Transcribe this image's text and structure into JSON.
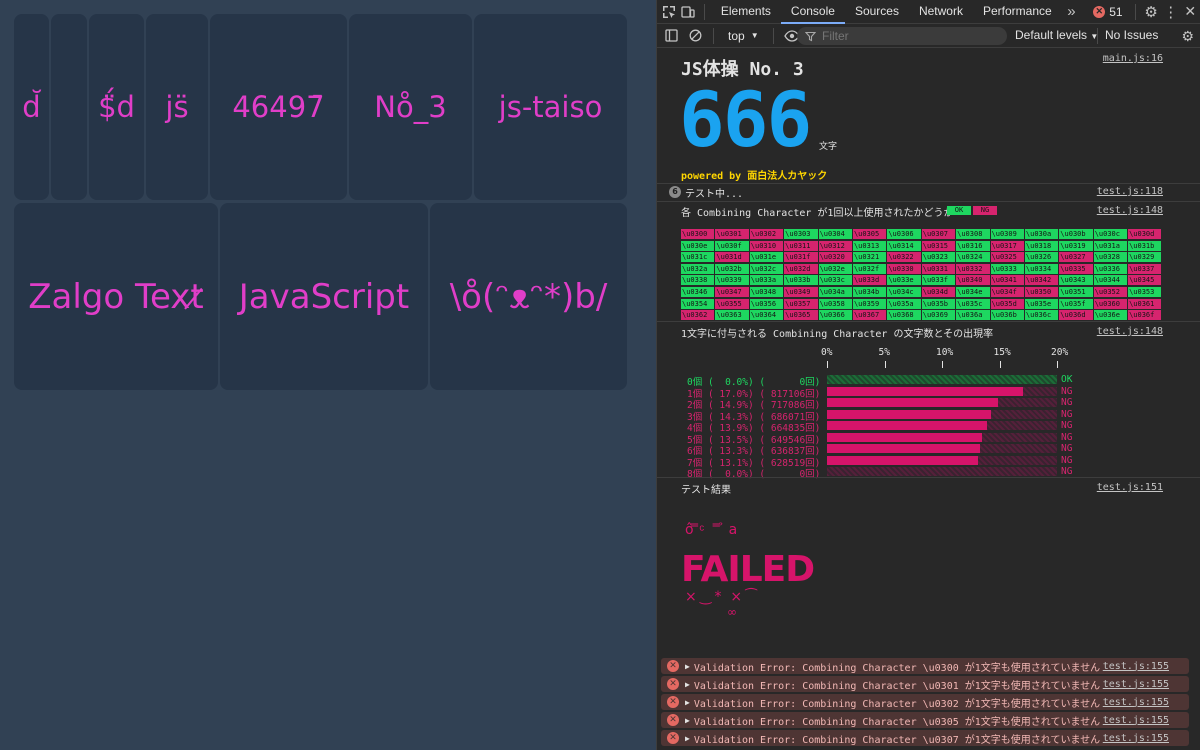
{
  "left_tiles": {
    "row1": [
      {
        "text": "d̆"
      },
      {
        "text": "$̈́d"
      },
      {
        "text": "js̈"
      },
      {
        "text": "46497̄"
      },
      {
        "text": "No̊_3"
      },
      {
        "text": "js-taiso"
      }
    ],
    "row2": [
      {
        "text": "Zalgo Text̷"
      },
      {
        "text": "JavaScript"
      },
      {
        "text": "\\o̊(ᵔᴥᵔ*)b/"
      }
    ]
  },
  "devtools": {
    "tabs": [
      "Elements",
      "Console",
      "Sources",
      "Network",
      "Performance"
    ],
    "more": "»",
    "error_count": "51",
    "toolbar": {
      "context": "top",
      "filter_placeholder": "Filter",
      "levels": "Default levels",
      "issues": "No Issues"
    },
    "console": {
      "title": "JS体操 No. 3",
      "title_src": "main.js:16",
      "big_count": "666",
      "big_unit": "文字",
      "powered_by": "powered by 面白法人カヤック",
      "group_count": "6",
      "testing": "テスト中...",
      "testing_src": "test.js:118",
      "check_label": "各 Combining Character が1回以上使用されたかどうか",
      "ok_badge": "OK",
      "ng_badge": "NG",
      "check_src": "test.js:148",
      "cells": [
        [
          "\\u0300",
          "ng"
        ],
        [
          "\\u0301",
          "ng"
        ],
        [
          "\\u0302",
          "ng"
        ],
        [
          "\\u0303",
          "ok"
        ],
        [
          "\\u0304",
          "ok"
        ],
        [
          "\\u0305",
          "ng"
        ],
        [
          "\\u0306",
          "ok"
        ],
        [
          "\\u0307",
          "ng"
        ],
        [
          "\\u0308",
          "ok"
        ],
        [
          "\\u0309",
          "ok"
        ],
        [
          "\\u030a",
          "ok"
        ],
        [
          "\\u030b",
          "ok"
        ],
        [
          "\\u030c",
          "ok"
        ],
        [
          "\\u030d",
          "ng"
        ],
        [
          "\\u030e",
          "ok"
        ],
        [
          "\\u030f",
          "ok"
        ],
        [
          "\\u0310",
          "ng"
        ],
        [
          "\\u0311",
          "ng"
        ],
        [
          "\\u0312",
          "ng"
        ],
        [
          "\\u0313",
          "ok"
        ],
        [
          "\\u0314",
          "ok"
        ],
        [
          "\\u0315",
          "ng"
        ],
        [
          "\\u0316",
          "ok"
        ],
        [
          "\\u0317",
          "ng"
        ],
        [
          "\\u0318",
          "ok"
        ],
        [
          "\\u0319",
          "ok"
        ],
        [
          "\\u031a",
          "ok"
        ],
        [
          "\\u031b",
          "ok"
        ],
        [
          "\\u031c",
          "ok"
        ],
        [
          "\\u031d",
          "ng"
        ],
        [
          "\\u031e",
          "ok"
        ],
        [
          "\\u031f",
          "ng"
        ],
        [
          "\\u0320",
          "ng"
        ],
        [
          "\\u0321",
          "ok"
        ],
        [
          "\\u0322",
          "ng"
        ],
        [
          "\\u0323",
          "ok"
        ],
        [
          "\\u0324",
          "ok"
        ],
        [
          "\\u0325",
          "ng"
        ],
        [
          "\\u0326",
          "ok"
        ],
        [
          "\\u0327",
          "ng"
        ],
        [
          "\\u0328",
          "ok"
        ],
        [
          "\\u0329",
          "ok"
        ],
        [
          "\\u032a",
          "ok"
        ],
        [
          "\\u032b",
          "ok"
        ],
        [
          "\\u032c",
          "ok"
        ],
        [
          "\\u032d",
          "ng"
        ],
        [
          "\\u032e",
          "ok"
        ],
        [
          "\\u032f",
          "ok"
        ],
        [
          "\\u0330",
          "ng"
        ],
        [
          "\\u0331",
          "ng"
        ],
        [
          "\\u0332",
          "ng"
        ],
        [
          "\\u0333",
          "ok"
        ],
        [
          "\\u0334",
          "ok"
        ],
        [
          "\\u0335",
          "ng"
        ],
        [
          "\\u0336",
          "ok"
        ],
        [
          "\\u0337",
          "ng"
        ],
        [
          "\\u0338",
          "ok"
        ],
        [
          "\\u0339",
          "ok"
        ],
        [
          "\\u033a",
          "ok"
        ],
        [
          "\\u033b",
          "ok"
        ],
        [
          "\\u033c",
          "ok"
        ],
        [
          "\\u033d",
          "ng"
        ],
        [
          "\\u033e",
          "ok"
        ],
        [
          "\\u033f",
          "ok"
        ],
        [
          "\\u0340",
          "ng"
        ],
        [
          "\\u0341",
          "ng"
        ],
        [
          "\\u0342",
          "ng"
        ],
        [
          "\\u0343",
          "ok"
        ],
        [
          "\\u0344",
          "ok"
        ],
        [
          "\\u0345",
          "ng"
        ],
        [
          "\\u0346",
          "ok"
        ],
        [
          "\\u0347",
          "ng"
        ],
        [
          "\\u0348",
          "ok"
        ],
        [
          "\\u0349",
          "ng"
        ],
        [
          "\\u034a",
          "ok"
        ],
        [
          "\\u034b",
          "ok"
        ],
        [
          "\\u034c",
          "ok"
        ],
        [
          "\\u034d",
          "ng"
        ],
        [
          "\\u034e",
          "ok"
        ],
        [
          "\\u034f",
          "ng"
        ],
        [
          "\\u0350",
          "ng"
        ],
        [
          "\\u0351",
          "ok"
        ],
        [
          "\\u0352",
          "ng"
        ],
        [
          "\\u0353",
          "ok"
        ],
        [
          "\\u0354",
          "ok"
        ],
        [
          "\\u0355",
          "ng"
        ],
        [
          "\\u0356",
          "ok"
        ],
        [
          "\\u0357",
          "ng"
        ],
        [
          "\\u0358",
          "ok"
        ],
        [
          "\\u0359",
          "ok"
        ],
        [
          "\\u035a",
          "ok"
        ],
        [
          "\\u035b",
          "ok"
        ],
        [
          "\\u035c",
          "ok"
        ],
        [
          "\\u035d",
          "ng"
        ],
        [
          "\\u035e",
          "ok"
        ],
        [
          "\\u035f",
          "ok"
        ],
        [
          "\\u0360",
          "ng"
        ],
        [
          "\\u0361",
          "ng"
        ],
        [
          "\\u0362",
          "ng"
        ],
        [
          "\\u0363",
          "ok"
        ],
        [
          "\\u0364",
          "ok"
        ],
        [
          "\\u0365",
          "ng"
        ],
        [
          "\\u0366",
          "ok"
        ],
        [
          "\\u0367",
          "ng"
        ],
        [
          "\\u0368",
          "ok"
        ],
        [
          "\\u0369",
          "ok"
        ],
        [
          "\\u036a",
          "ok"
        ],
        [
          "\\u036b",
          "ok"
        ],
        [
          "\\u036c",
          "ok"
        ],
        [
          "\\u036d",
          "ng"
        ],
        [
          "\\u036e",
          "ok"
        ],
        [
          "\\u036f",
          "ng"
        ]
      ],
      "dist_label": "1文字に付与される Combining Character の文字数とその出現率",
      "dist_src": "test.js:148",
      "result_label": "テスト結果",
      "result_src": "test.js:151",
      "failed_text": "FAILED",
      "errors": [
        "Validation Error: Combining Character \\u0300 が1文字も使用されていません",
        "Validation Error: Combining Character \\u0301 が1文字も使用されていません",
        "Validation Error: Combining Character \\u0302 が1文字も使用されていません",
        "Validation Error: Combining Character \\u0305 が1文字も使用されていません",
        "Validation Error: Combining Character \\u0307 が1文字も使用されていません"
      ],
      "error_src": "test.js:155"
    }
  },
  "chart_data": {
    "type": "bar",
    "orientation": "horizontal",
    "x_ticks": [
      "0%",
      "5%",
      "10%",
      "15%",
      "20%"
    ],
    "xlim": [
      0,
      20
    ],
    "rows": [
      {
        "label": "0個 (  0.0%) (      0回)",
        "percent": 0.0,
        "count": 0,
        "status": "OK"
      },
      {
        "label": "1個 ( 17.0%) ( 817106回)",
        "percent": 17.0,
        "count": 817106,
        "status": "NG"
      },
      {
        "label": "2個 ( 14.9%) ( 717086回)",
        "percent": 14.9,
        "count": 717086,
        "status": "NG"
      },
      {
        "label": "3個 ( 14.3%) ( 686071回)",
        "percent": 14.3,
        "count": 686071,
        "status": "NG"
      },
      {
        "label": "4個 ( 13.9%) ( 664835回)",
        "percent": 13.9,
        "count": 664835,
        "status": "NG"
      },
      {
        "label": "5個 ( 13.5%) ( 649546回)",
        "percent": 13.5,
        "count": 649546,
        "status": "NG"
      },
      {
        "label": "6個 ( 13.3%) ( 636837回)",
        "percent": 13.3,
        "count": 636837,
        "status": "NG"
      },
      {
        "label": "7個 ( 13.1%) ( 628519回)",
        "percent": 13.1,
        "count": 628519,
        "status": "NG"
      },
      {
        "label": "8個 (  0.0%) (      0回)",
        "percent": 0.0,
        "count": 0,
        "status": "NG"
      }
    ]
  },
  "colors": {
    "accent_blue": "#1aa3f0",
    "pink_text": "#e03ec8",
    "ok_green": "#1ed760",
    "ng_red": "#d6246e",
    "powered_yellow": "#ffd600"
  }
}
